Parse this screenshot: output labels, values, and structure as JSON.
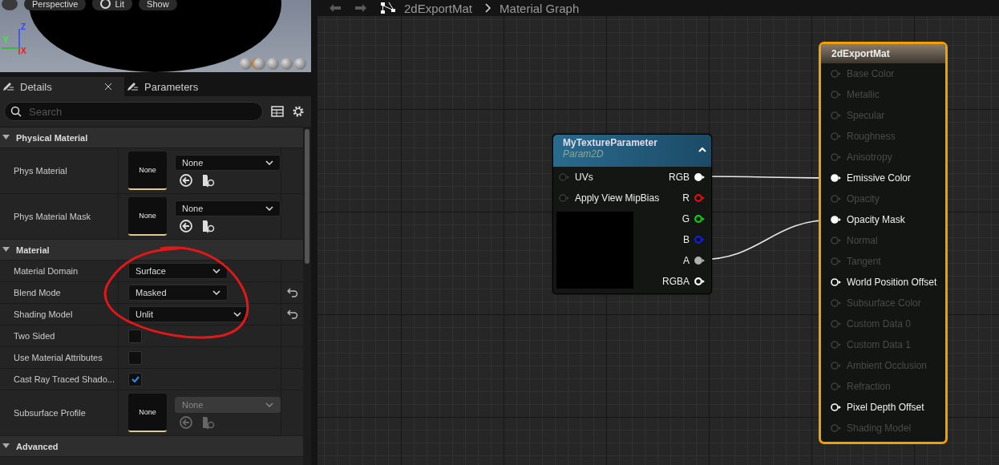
{
  "viewport": {
    "toolbar": [
      {
        "label": "Perspective",
        "icon": false
      },
      {
        "label": "Lit",
        "icon": true
      },
      {
        "label": "Show",
        "icon": false
      }
    ],
    "axes": [
      {
        "label": "Z",
        "color": "#3048ff"
      },
      {
        "label": "Y",
        "color": "#30f030"
      },
      {
        "label": "X",
        "color": "#e02020"
      }
    ]
  },
  "details": {
    "tabs": [
      {
        "label": "Details",
        "selected": true,
        "closable": true
      },
      {
        "label": "Parameters",
        "selected": false,
        "closable": false
      }
    ],
    "search": {
      "placeholder": "Search"
    },
    "sections": [
      {
        "title": "Physical Material",
        "expanded": true,
        "rows": [
          {
            "kind": "asset",
            "label": "Phys Material",
            "thumbnail": "None",
            "value": "None",
            "disabled": false
          },
          {
            "kind": "asset",
            "label": "Phys Material Mask",
            "thumbnail": "None",
            "value": "None",
            "disabled": false
          }
        ]
      },
      {
        "title": "Material",
        "expanded": true,
        "rows": [
          {
            "kind": "dropdown",
            "label": "Material Domain",
            "value": "Surface",
            "resettable": false
          },
          {
            "kind": "dropdown",
            "label": "Blend Mode",
            "value": "Masked",
            "resettable": true
          },
          {
            "kind": "dropdown",
            "label": "Shading Model",
            "value": "Unlit",
            "resettable": true
          },
          {
            "kind": "checkbox",
            "label": "Two Sided",
            "checked": false
          },
          {
            "kind": "checkbox",
            "label": "Use Material Attributes",
            "checked": false
          },
          {
            "kind": "checkbox",
            "label": "Cast Ray Traced Shado...",
            "checked": true
          },
          {
            "kind": "asset",
            "label": "Subsurface Profile",
            "thumbnail": "None",
            "value": "None",
            "disabled": true
          }
        ]
      },
      {
        "title": "Advanced",
        "expanded": true
      }
    ]
  },
  "graph": {
    "breadcrumb": [
      "2dExportMat",
      "Material Graph"
    ],
    "texture_node": {
      "title": "MyTextureParameter",
      "subtitle": "Param2D",
      "inputs": [
        {
          "label": "UVs",
          "connected": false
        },
        {
          "label": "Apply View MipBias",
          "connected": false
        }
      ],
      "outputs": [
        {
          "label": "RGB",
          "color": "#ffffff",
          "connected": true
        },
        {
          "label": "R",
          "color": "#e01010",
          "connected": false
        },
        {
          "label": "G",
          "color": "#10d010",
          "connected": false
        },
        {
          "label": "B",
          "color": "#1020e0",
          "connected": false
        },
        {
          "label": "A",
          "color": "#b0b0b0",
          "connected": true
        },
        {
          "label": "RGBA",
          "color": "#ffffff",
          "connected": false
        }
      ]
    },
    "material_node": {
      "title": "2dExportMat",
      "selected": true,
      "inputs": [
        {
          "label": "Base Color",
          "active": false,
          "connected": false
        },
        {
          "label": "Metallic",
          "active": false,
          "connected": false
        },
        {
          "label": "Specular",
          "active": false,
          "connected": false
        },
        {
          "label": "Roughness",
          "active": false,
          "connected": false
        },
        {
          "label": "Anisotropy",
          "active": false,
          "connected": false
        },
        {
          "label": "Emissive Color",
          "active": true,
          "connected": true
        },
        {
          "label": "Opacity",
          "active": false,
          "connected": false
        },
        {
          "label": "Opacity Mask",
          "active": true,
          "connected": true
        },
        {
          "label": "Normal",
          "active": false,
          "connected": false
        },
        {
          "label": "Tangent",
          "active": false,
          "connected": false
        },
        {
          "label": "World Position Offset",
          "active": true,
          "connected": false
        },
        {
          "label": "Subsurface Color",
          "active": false,
          "connected": false
        },
        {
          "label": "Custom Data 0",
          "active": false,
          "connected": false
        },
        {
          "label": "Custom Data 1",
          "active": false,
          "connected": false
        },
        {
          "label": "Ambient Occlusion",
          "active": false,
          "connected": false
        },
        {
          "label": "Refraction",
          "active": false,
          "connected": false
        },
        {
          "label": "Pixel Depth Offset",
          "active": true,
          "connected": false
        },
        {
          "label": "Shading Model",
          "active": false,
          "connected": false
        }
      ]
    }
  }
}
